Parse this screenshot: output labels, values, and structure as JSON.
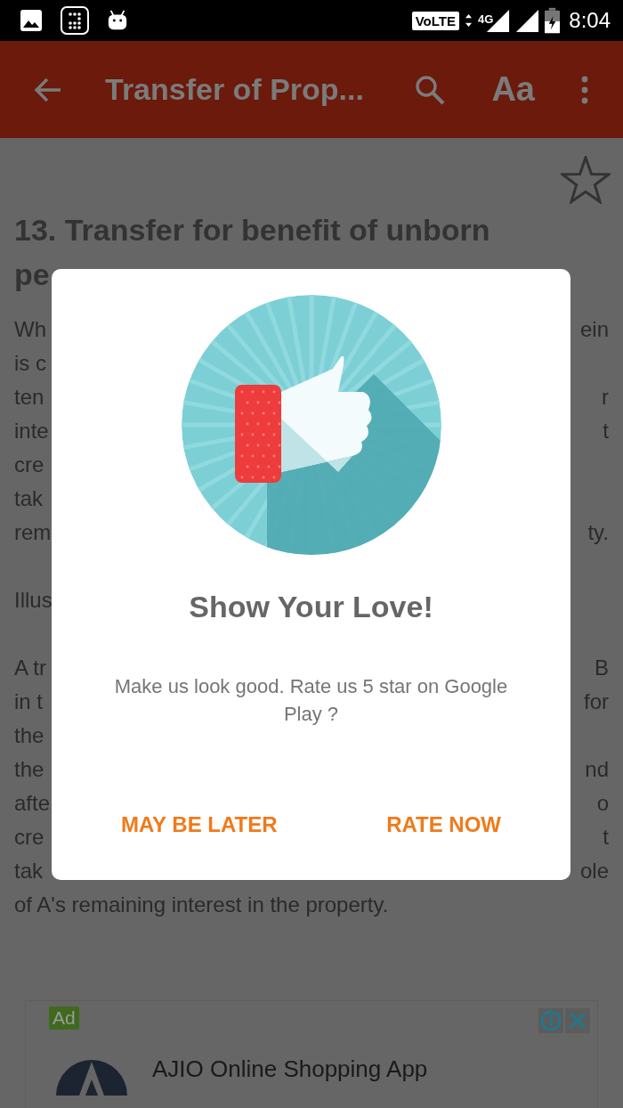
{
  "status_bar": {
    "volte": "VoLTE",
    "network": "4G",
    "time": "8:04"
  },
  "toolbar": {
    "title": "Transfer of Prop...",
    "font_button": "Aa"
  },
  "article": {
    "bookmarked": false,
    "heading_lines": [
      "13. Transfer for benefit of unborn",
      "pe"
    ],
    "paragraphs": [
      [
        {
          "left": "Wh",
          "right": "ein"
        },
        {
          "left": "is c"
        },
        {
          "left": "ten",
          "right": "r"
        },
        {
          "left": "inte",
          "right": "t"
        },
        {
          "left": "cre"
        },
        {
          "left": "tak"
        },
        {
          "left": "rem",
          "right": "ty."
        }
      ],
      [
        {
          "left": "Illus"
        }
      ],
      [
        {
          "left": "A tr",
          "right": "B"
        },
        {
          "left": "in t",
          "right": "for"
        },
        {
          "left": "the"
        },
        {
          "left": "the",
          "right": "nd"
        },
        {
          "left": "afte",
          "right": "o"
        },
        {
          "left": "cre",
          "right": "t"
        },
        {
          "left": "tak",
          "right": "ole"
        },
        {
          "left": "of A's remaining interest in the property."
        }
      ]
    ]
  },
  "dialog": {
    "title": "Show Your Love!",
    "message": "Make us look good. Rate us 5 star on Google Play ?",
    "buttons": [
      {
        "label": "MAY BE LATER"
      },
      {
        "label": "RATE NOW"
      }
    ]
  },
  "ad": {
    "badge": "Ad",
    "title": "AJIO Online Shopping App"
  }
}
